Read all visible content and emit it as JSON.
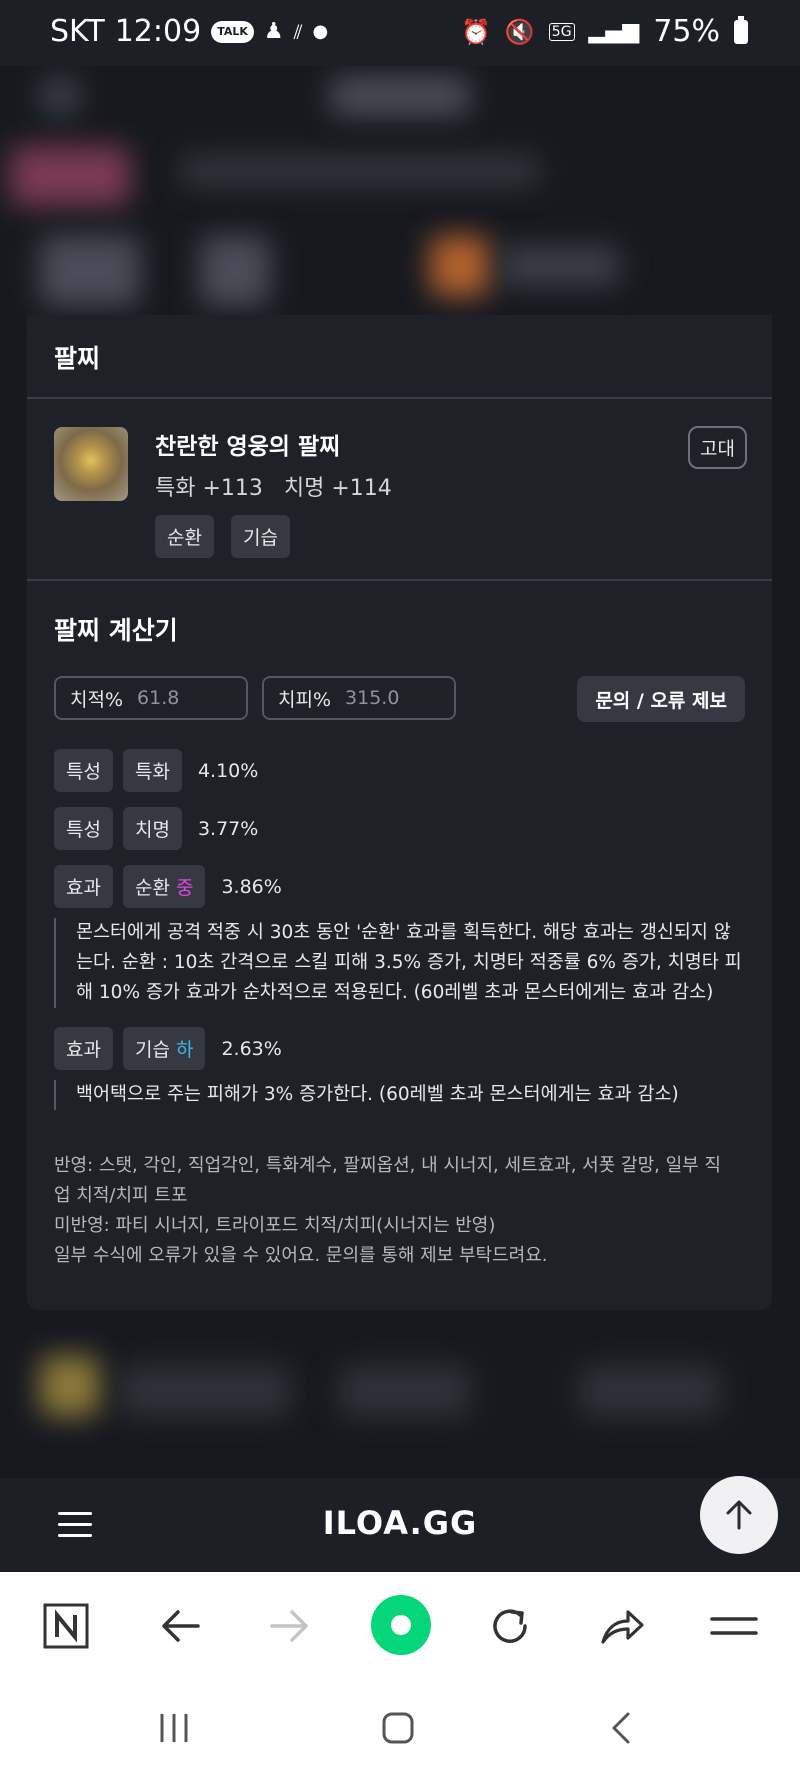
{
  "status_bar": {
    "carrier": "SKT",
    "time": "12:09",
    "network": "5G",
    "battery": "75%"
  },
  "modal": {
    "title": "팔찌",
    "item": {
      "name": "찬란한 영웅의 팔찌",
      "stats": "특화 +113   치명 +114",
      "grade": "고대",
      "tags": [
        "순환",
        "기습"
      ]
    },
    "calculator": {
      "title": "팔찌 계산기",
      "crit_rate_label": "치적%",
      "crit_rate_value": "61.8",
      "crit_dmg_label": "치피%",
      "crit_dmg_value": "315.0",
      "report_button": "문의 / 오류 제보",
      "rows": [
        {
          "type": "특성",
          "name": "특화",
          "grade": "",
          "value": "4.10%"
        },
        {
          "type": "특성",
          "name": "치명",
          "grade": "",
          "value": "3.77%"
        },
        {
          "type": "효과",
          "name": "순환",
          "grade": "중",
          "value": "3.86%",
          "desc": "몬스터에게 공격 적중 시 30초 동안 '순환' 효과를 획득한다. 해당 효과는 갱신되지 않는다. 순환 : 10초 간격으로 스킬 피해 3.5% 증가, 치명타 적중률 6% 증가, 치명타 피해 10% 증가 효과가 순차적으로 적용된다. (60레벨 초과 몬스터에게는 효과 감소)"
        },
        {
          "type": "효과",
          "name": "기습",
          "grade": "하",
          "value": "2.63%",
          "desc": "백어택으로 주는 피해가 3% 증가한다. (60레벨 초과 몬스터에게는 효과 감소)"
        }
      ],
      "notes": [
        "반영: 스탯, 각인, 직업각인, 특화계수, 팔찌옵션, 내 시너지, 세트효과, 서폿 갈망, 일부 직업 치적/치피 트포",
        "미반영: 파티 시너지, 트라이포드 치적/치피(시너지는 반영)",
        "일부 수식에 오류가 있을 수 있어요. 문의를 통해 제보 부탁드려요."
      ]
    }
  },
  "site_bar": {
    "logo": "ILOA.GG"
  },
  "colors": {
    "grade_mid": "#e145e6",
    "grade_low": "#3ab7e6",
    "modal_bg": "#1f2128",
    "chip_bg": "#363942",
    "browser_green": "#06d67a"
  }
}
